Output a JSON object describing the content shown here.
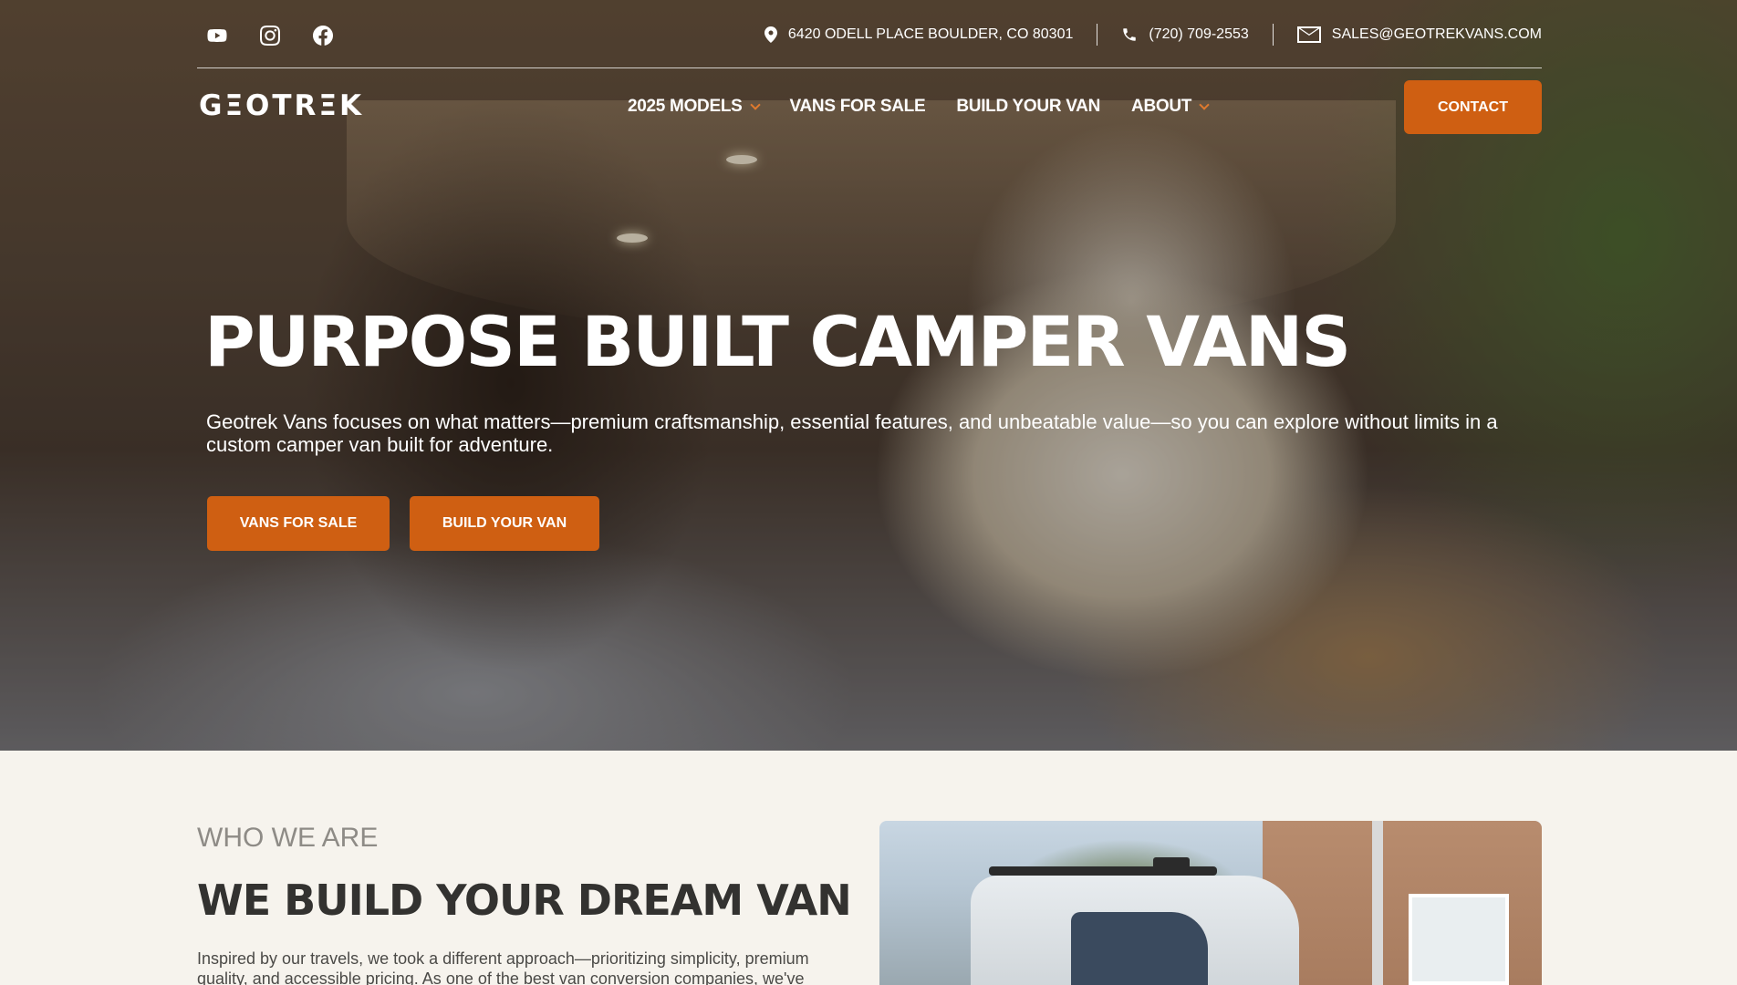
{
  "topbar": {
    "social": [
      {
        "icon": "youtube-icon"
      },
      {
        "icon": "instagram-icon"
      },
      {
        "icon": "facebook-icon"
      }
    ],
    "address": "6420 ODELL PLACE BOULDER, CO 80301",
    "phone": "(720) 709-2553",
    "email": "SALES@GEOTREKVANS.COM"
  },
  "nav": {
    "logo": "GΞOTRΞK",
    "items": [
      {
        "label": "2025 MODELS",
        "dropdown": true
      },
      {
        "label": "VANS FOR SALE",
        "dropdown": false
      },
      {
        "label": "BUILD YOUR VAN",
        "dropdown": false
      },
      {
        "label": "ABOUT",
        "dropdown": true
      }
    ],
    "contact_label": "CONTACT"
  },
  "hero": {
    "title": "PURPOSE BUILT CAMPER VANS",
    "subtitle": "Geotrek Vans focuses on what matters—premium craftsmanship, essential features, and unbeatable value—so you can explore without limits in a custom camper van built for adventure.",
    "buttons": [
      "VANS FOR SALE",
      "BUILD YOUR VAN"
    ]
  },
  "about": {
    "eyebrow": "WHO WE ARE",
    "title": "WE BUILD YOUR DREAM VAN",
    "body": "Inspired by our travels, we took a different approach—prioritizing simplicity, premium quality, and accessible pricing. As one of the best van conversion companies, we've perfected our"
  },
  "colors": {
    "accent": "#cf5f12",
    "caret": "#e07a2e",
    "section_bg": "#f6f3ed",
    "heading": "#333230"
  }
}
